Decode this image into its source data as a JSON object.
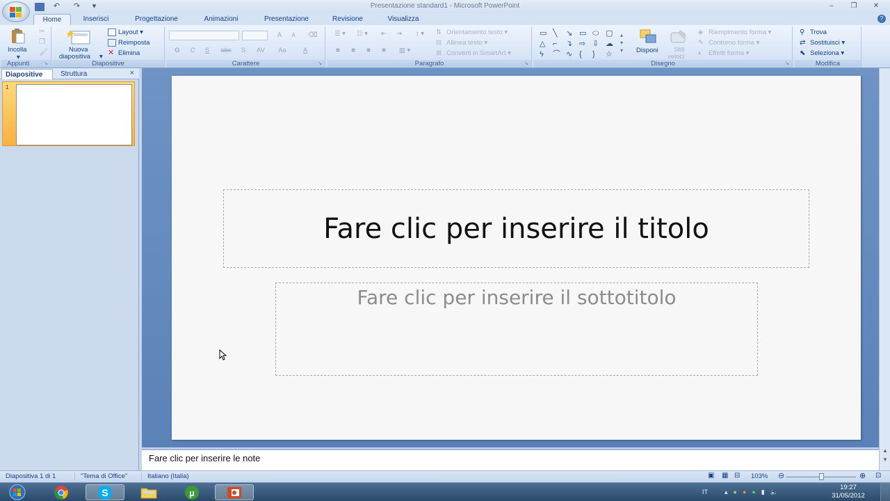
{
  "window": {
    "title": "Presentazione standard1  -  Microsoft PowerPoint",
    "minimize": "–",
    "maximize": "❐",
    "close": "✕"
  },
  "qat": {
    "save": "💾",
    "undo": "↶",
    "redo": "↷",
    "customize": "▾"
  },
  "tabs": [
    "Home",
    "Inserisci",
    "Progettazione",
    "Animazioni",
    "Presentazione",
    "Revisione",
    "Visualizza"
  ],
  "ribbon": {
    "appunti": {
      "label": "Appunti",
      "paste": "Incolla"
    },
    "diapositive": {
      "label": "Diapositive",
      "new_slide_1": "Nuova",
      "new_slide_2": "diapositiva",
      "layout": "Layout",
      "reset": "Reimposta",
      "delete": "Elimina"
    },
    "carattere": {
      "label": "Carattere",
      "bold": "G",
      "italic": "C",
      "underline": "S",
      "strike": "abc",
      "shadow": "S",
      "spacing": "AV",
      "case": "Aa",
      "color": "A",
      "grow": "A",
      "shrink": "A"
    },
    "paragrafo": {
      "label": "Paragrafo",
      "text_direction": "Orientamento testo",
      "align_text": "Allinea testo",
      "smartart": "Converti in SmartArt"
    },
    "disegno": {
      "label": "Disegno",
      "arrange": "Disponi",
      "quick_styles_1": "Stili",
      "quick_styles_2": "veloci",
      "shape_fill": "Riempimento forma",
      "shape_outline": "Contorno forma",
      "shape_effects": "Effetti forma"
    },
    "modifica": {
      "label": "Modifica",
      "find": "Trova",
      "replace": "Sostituisci",
      "select": "Seleziona"
    }
  },
  "left_pane": {
    "tab_slides": "Diapositive",
    "tab_outline": "Struttura",
    "close": "×",
    "thumb_number": "1"
  },
  "slide": {
    "title_placeholder": "Fare clic per inserire il titolo",
    "subtitle_placeholder": "Fare clic per inserire il sottotitolo"
  },
  "notes": {
    "placeholder": "Fare clic per inserire le note"
  },
  "status": {
    "slide_info": "Diapositiva 1 di 1",
    "theme": "\"Tema di Office\"",
    "language": "Italiano (Italia)",
    "zoom": "103%"
  },
  "taskbar": {
    "language": "IT",
    "time": "19:27",
    "date": "31/05/2012"
  },
  "colors": {
    "accent": "#15428b",
    "ribbon_bg": "#dbe7f6",
    "workspace_bg": "#6e93c5",
    "thumb_highlight": "#f8b13f"
  }
}
